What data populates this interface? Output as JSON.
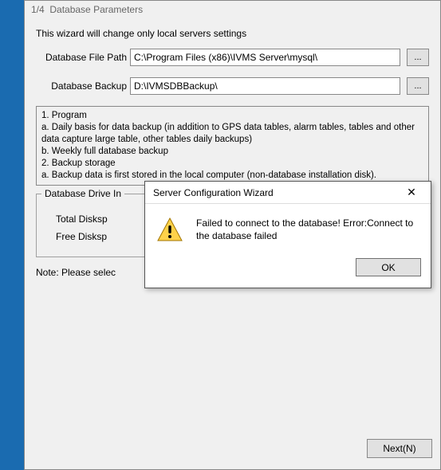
{
  "window": {
    "step": "1/4",
    "step_title": "Database Parameters"
  },
  "intro": "This wizard will change only local servers settings",
  "fields": {
    "db_path_label": "Database File Path",
    "db_path_value": "C:\\Program Files (x86)\\IVMS Server\\mysql\\",
    "db_backup_label": "Database Backup",
    "db_backup_value": "D:\\IVMSDBBackup\\",
    "browse_label": "..."
  },
  "infobox": {
    "l1": "1. Program",
    "l2": "  a. Daily basis for data backup (in addition to GPS data tables, alarm tables, tables and other data capture large table, other tables daily backups)",
    "l3": "  b. Weekly full database backup",
    "l4": "2. Backup storage",
    "l5": "  a. Backup data is first stored in the local computer (non-database installation disk)."
  },
  "drive_group": {
    "legend": "Database Drive In",
    "total_label": "Total Disksp",
    "free_label": "Free Disksp"
  },
  "note": "Note: Please selec",
  "next_label": "Next(N)",
  "modal": {
    "title": "Server Configuration Wizard",
    "message": "Failed to connect to the database! Error:Connect to the database failed",
    "ok_label": "OK",
    "close_glyph": "✕"
  }
}
